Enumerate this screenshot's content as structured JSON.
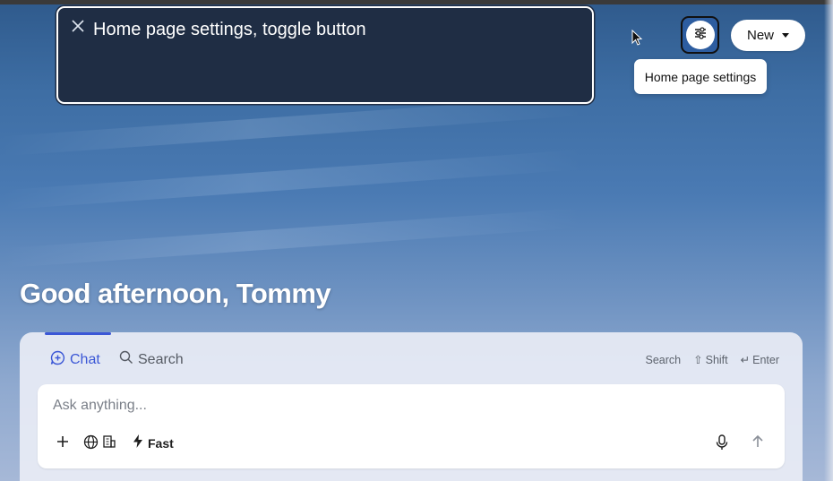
{
  "announcement": {
    "text": "Home page settings, toggle button"
  },
  "header": {
    "tooltip": "Home page settings",
    "new_button": "New"
  },
  "greeting": "Good afternoon, Tommy",
  "composer": {
    "tabs": [
      {
        "label": "Chat",
        "active": true
      },
      {
        "label": "Search",
        "active": false
      }
    ],
    "hints": {
      "search": "Search",
      "shift": "Shift",
      "enter": "Enter"
    },
    "placeholder": "Ask anything...",
    "mode_label": "Fast"
  },
  "colors": {
    "accent": "#3b57d6",
    "announcement_bg": "#1f2d44"
  }
}
